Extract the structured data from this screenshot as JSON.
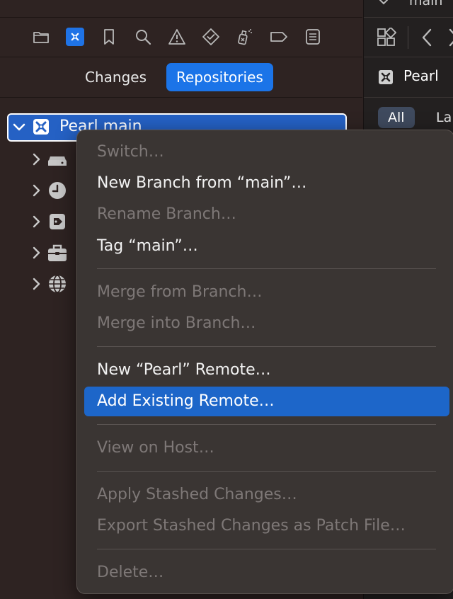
{
  "navigator": {
    "toolbar_icons": [
      "folder-icon",
      "source-control-icon",
      "bookmark-icon",
      "search-icon",
      "warning-icon",
      "test-diamond-icon",
      "debug-spray-icon",
      "breakpoint-tag-icon",
      "report-list-icon"
    ],
    "tabs": [
      {
        "label": "Changes",
        "selected": false
      },
      {
        "label": "Repositories",
        "selected": true
      }
    ],
    "tree": {
      "root_label": "Pearl main",
      "children_icons": [
        "branches-drive-icon",
        "clock-icon",
        "tag-icon",
        "stash-box-icon",
        "remotes-globe-icon"
      ]
    }
  },
  "editor": {
    "top_title": "main",
    "tab_label": "Pearl",
    "filters": [
      "All",
      "La"
    ]
  },
  "context_menu": {
    "items": [
      {
        "label": "Switch…",
        "enabled": false,
        "highlighted": false
      },
      {
        "label": "New Branch from “main”…",
        "enabled": true,
        "highlighted": false
      },
      {
        "label": "Rename Branch…",
        "enabled": false,
        "highlighted": false
      },
      {
        "label": "Tag “main”…",
        "enabled": true,
        "highlighted": false
      },
      {
        "label": "Merge from Branch…",
        "enabled": false,
        "highlighted": false
      },
      {
        "label": "Merge into Branch…",
        "enabled": false,
        "highlighted": false
      },
      {
        "label": "New “Pearl” Remote…",
        "enabled": true,
        "highlighted": false
      },
      {
        "label": "Add Existing Remote…",
        "enabled": true,
        "highlighted": true
      },
      {
        "label": "View on Host…",
        "enabled": false,
        "highlighted": false
      },
      {
        "label": "Apply Stashed Changes…",
        "enabled": false,
        "highlighted": false
      },
      {
        "label": "Export Stashed Changes as Patch File…",
        "enabled": false,
        "highlighted": false
      },
      {
        "label": "Delete…",
        "enabled": false,
        "highlighted": false
      }
    ]
  },
  "colors": {
    "accent": "#1b74e8",
    "menu_highlight": "#1d66c9",
    "background": "#2e2322"
  }
}
